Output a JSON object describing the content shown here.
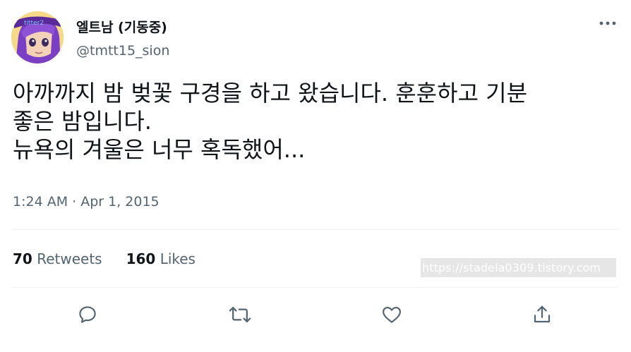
{
  "user": {
    "display_name": "엘트남 (기동중)",
    "handle": "@tmtt15_sion",
    "avatar_badge": "titter2"
  },
  "tweet": {
    "lines": [
      "아까까지 밤 벚꽃 구경을 하고 왔습니다. 훈훈하고 기분",
      "좋은 밤입니다.",
      "뉴욕의 겨울은 너무 혹독했어..."
    ],
    "timestamp": "1:24 AM · Apr 1, 2015"
  },
  "stats": {
    "retweets_count": "70",
    "retweets_label": "Retweets",
    "likes_count": "160",
    "likes_label": "Likes"
  },
  "watermark": "https://stadela0309.tistory.com",
  "icons": {
    "more": "more-horizontal-icon",
    "reply": "reply-icon",
    "retweet": "retweet-icon",
    "like": "heart-icon",
    "share": "share-icon"
  },
  "colors": {
    "text": "#0f1419",
    "secondary": "#536471",
    "divider": "#eff3f4"
  }
}
